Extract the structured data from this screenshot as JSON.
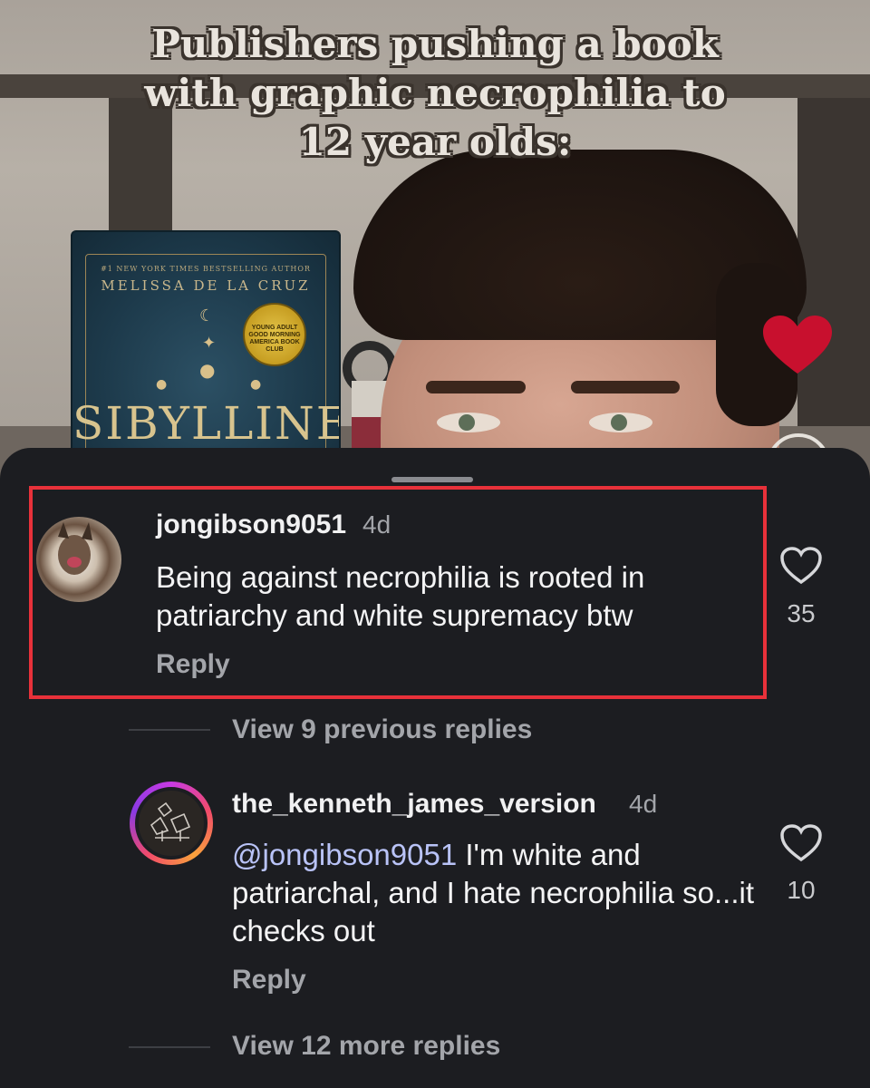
{
  "video": {
    "caption_lines": [
      "Publishers pushing a book",
      "with graphic necrophilia to",
      "12 year olds:"
    ],
    "book": {
      "tagline": "#1 NEW YORK TIMES BESTSELLING AUTHOR",
      "author": "MELISSA DE LA CRUZ",
      "medal": "YOUNG ADULT\nGOOD MORNING AMERICA\nBOOK CLUB",
      "title": "SIBYLLINE"
    }
  },
  "comments": [
    {
      "username": "jongibson9051",
      "age": "4d",
      "text": "Being against necrophilia is rooted in patriarchy and white supremacy btw",
      "reply_label": "Reply",
      "likes": "35"
    },
    {
      "username": "the_kenneth_james_version",
      "age": "4d",
      "mention": "@jongibson9051",
      "text": " I'm white and patriarchal, and I hate necrophilia so...it checks out",
      "reply_label": "Reply",
      "likes": "10"
    }
  ],
  "links": {
    "previous_replies": "View 9 previous replies",
    "more_replies": "View 12 more replies"
  },
  "colors": {
    "highlight": "#e8313a",
    "heart": "#c8102e",
    "sheet_bg": "#1c1d21"
  }
}
